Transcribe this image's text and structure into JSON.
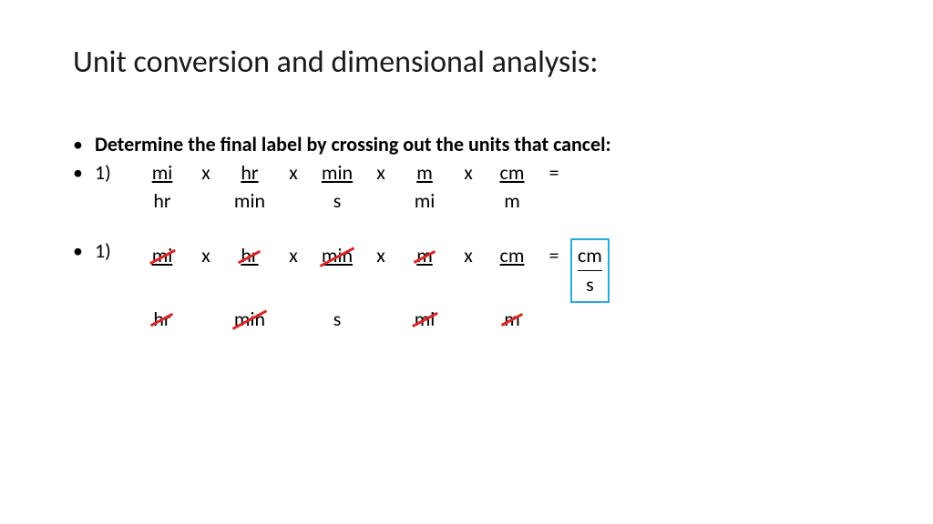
{
  "title": "Unit conversion and dimensional analysis:",
  "instruction": "Determine the final label by crossing out the units that cancel:",
  "problems": [
    {
      "label": "1)",
      "fractions": [
        {
          "num": "mi",
          "den": "hr"
        },
        {
          "num": "hr",
          "den": "min"
        },
        {
          "num": "min",
          "den": "s"
        },
        {
          "num": "m",
          "den": "mi"
        },
        {
          "num": "cm",
          "den": "m"
        }
      ],
      "op": "x",
      "equals": "="
    },
    {
      "label": "1)",
      "fractions": [
        {
          "num": "mi",
          "den": "hr",
          "num_strike": true,
          "den_strike": true
        },
        {
          "num": "hr",
          "den": "min",
          "num_strike": true,
          "den_strike": true
        },
        {
          "num": "min",
          "den": "s",
          "num_strike": true,
          "den_strike": false
        },
        {
          "num": "m",
          "den": "mi",
          "num_strike": true,
          "den_strike": true
        },
        {
          "num": "cm",
          "den": "m",
          "num_strike": false,
          "den_strike": true
        }
      ],
      "op": "x",
      "equals": "=",
      "answer": {
        "num": "cm",
        "den": "s"
      }
    }
  ]
}
